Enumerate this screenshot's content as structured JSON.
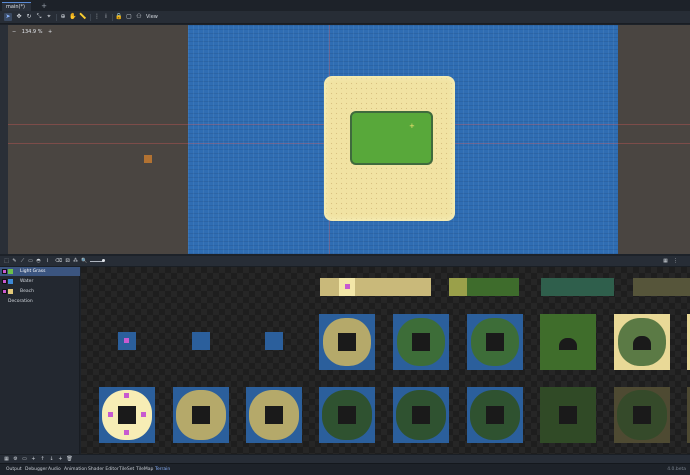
{
  "tab": {
    "label": "main(*)"
  },
  "toolbar": {
    "view_label": "View"
  },
  "viewport": {
    "zoom": "134.9 %"
  },
  "layers": [
    {
      "label": "Light Grass",
      "color": "#6cc04a",
      "selected": true
    },
    {
      "label": "Water",
      "color": "#3d88d6",
      "selected": false
    },
    {
      "label": "Beach",
      "color": "#e3c97a",
      "selected": false
    },
    {
      "label": "Decoration",
      "color": "",
      "selected": false
    }
  ],
  "status": {
    "output": "Output",
    "debugger": "Debugger",
    "audio": "Audio",
    "animation": "Animation",
    "shader": "Shader Editor",
    "tileset": "TileSet",
    "tilemap": "TileMap",
    "terrain": "Terrain",
    "version": "4.0.beta"
  },
  "colors": {
    "accent": "#5a8bd6",
    "selection": "#3b5580",
    "water": "#2f6db3",
    "beach": "#f1e3a3",
    "grass": "#58a83a"
  }
}
